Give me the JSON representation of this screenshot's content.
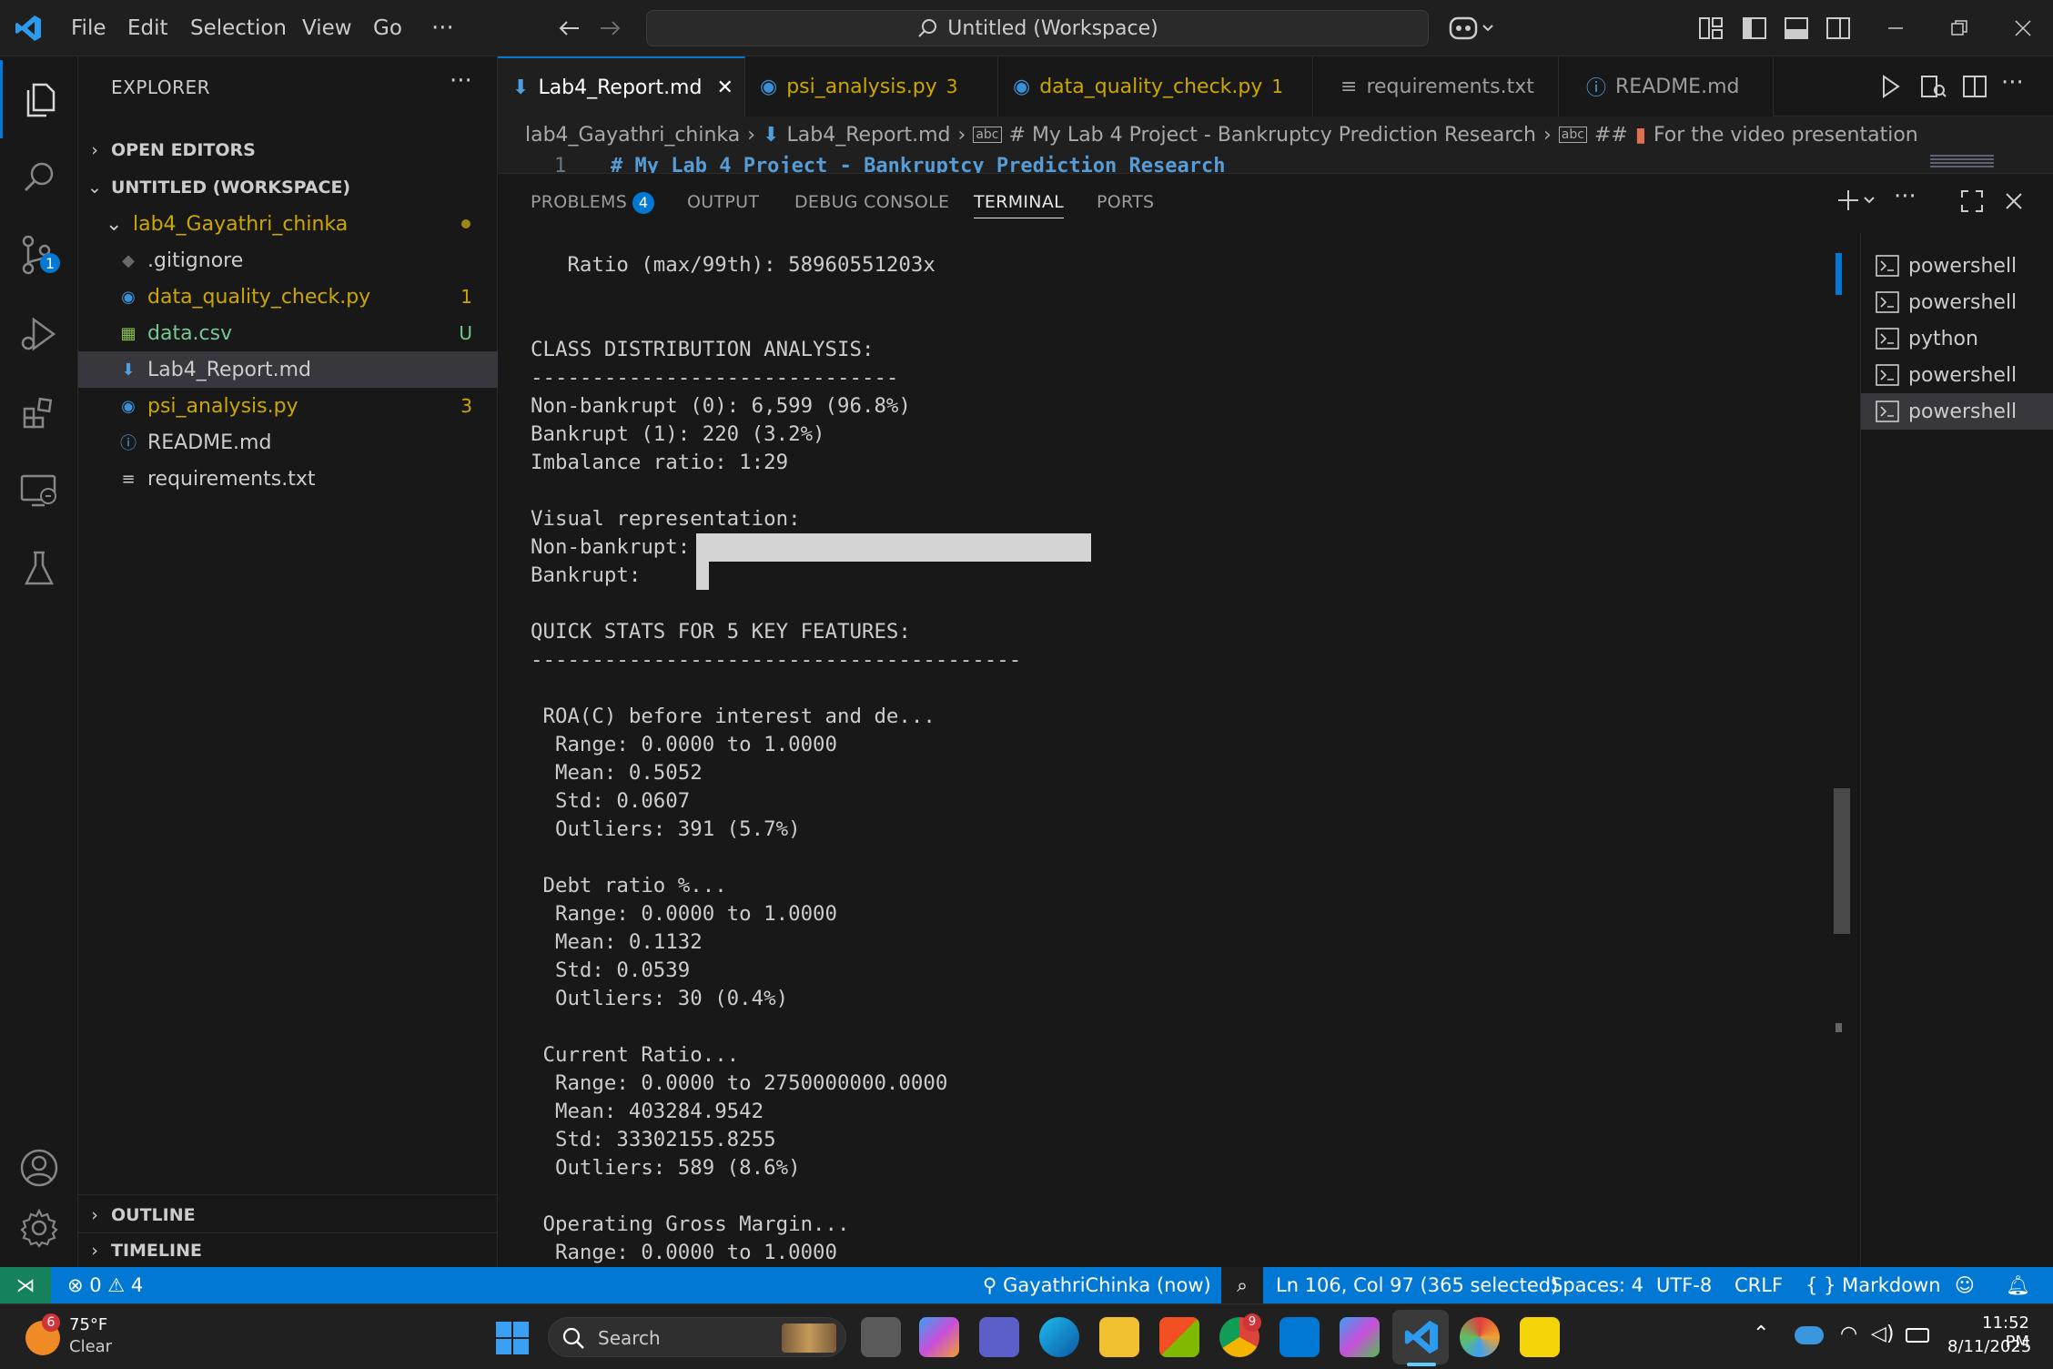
{
  "titlebar": {
    "menu": [
      "File",
      "Edit",
      "Selection",
      "View",
      "Go"
    ],
    "more": "···",
    "command_center": "Untitled (Workspace)"
  },
  "sidebar": {
    "title": "EXPLORER",
    "more": "···",
    "open_editors": "OPEN EDITORS",
    "workspace": "UNTITLED (WORKSPACE)",
    "folder": "lab4_Gayathri_chinka",
    "files": [
      {
        "name": ".gitignore",
        "badge": "",
        "color": "#cccccc",
        "icon": "gitignore-icon"
      },
      {
        "name": "data_quality_check.py",
        "badge": "1",
        "color": "#cca700",
        "icon": "python-icon"
      },
      {
        "name": "data.csv",
        "badge": "U",
        "color": "#73c991",
        "icon": "csv-icon"
      },
      {
        "name": "Lab4_Report.md",
        "badge": "",
        "color": "#cccccc",
        "icon": "markdown-icon"
      },
      {
        "name": "psi_analysis.py",
        "badge": "3",
        "color": "#cca700",
        "icon": "python-icon"
      },
      {
        "name": "README.md",
        "badge": "",
        "color": "#cccccc",
        "icon": "info-icon"
      },
      {
        "name": "requirements.txt",
        "badge": "",
        "color": "#cccccc",
        "icon": "text-file-icon"
      }
    ],
    "outline": "OUTLINE",
    "timeline": "TIMELINE"
  },
  "tabs": [
    {
      "label": "Lab4_Report.md",
      "num": "",
      "active": true
    },
    {
      "label": "psi_analysis.py",
      "num": "3",
      "active": false
    },
    {
      "label": "data_quality_check.py",
      "num": "1",
      "active": false
    },
    {
      "label": "requirements.txt",
      "num": "",
      "active": false
    },
    {
      "label": "README.md",
      "num": "",
      "active": false
    }
  ],
  "breadcrumb": {
    "folder": "lab4_Gayathri_chinka",
    "file": "Lab4_Report.md",
    "h1": "# My Lab 4 Project - Bankruptcy Prediction Research",
    "h2": "##",
    "h3": "For the video presentation"
  },
  "editor": {
    "line_no": "1",
    "line_text": "# My Lab 4 Project - Bankruptcy Prediction Research"
  },
  "panel": {
    "tabs": [
      "PROBLEMS",
      "OUTPUT",
      "DEBUG CONSOLE",
      "TERMINAL",
      "PORTS"
    ],
    "problems_count": "4",
    "active": "TERMINAL"
  },
  "terminal": {
    "lines": [
      "   Ratio (max/99th): 58960551203x",
      "",
      "",
      "CLASS DISTRIBUTION ANALYSIS:",
      "------------------------------",
      "Non-bankrupt (0): 6,599 (96.8%)",
      "Bankrupt (1): 220 (3.2%)",
      "Imbalance ratio: 1:29",
      "",
      "Visual representation:",
      "Non-bankrupt: ",
      "Bankrupt:     ",
      "",
      "QUICK STATS FOR 5 KEY FEATURES:",
      "----------------------------------------",
      "",
      " ROA(C) before interest and de...",
      "  Range: 0.0000 to 1.0000",
      "  Mean: 0.5052",
      "  Std: 0.0607",
      "  Outliers: 391 (5.7%)",
      "",
      " Debt ratio %...",
      "  Range: 0.0000 to 1.0000",
      "  Mean: 0.1132",
      "  Std: 0.0539",
      "  Outliers: 30 (0.4%)",
      "",
      " Current Ratio...",
      "  Range: 0.0000 to 2750000000.0000",
      "  Mean: 403284.9542",
      "  Std: 33302155.8255",
      "  Outliers: 589 (8.6%)",
      "",
      " Operating Gross Margin...",
      "  Range: 0.0000 to 1.0000"
    ],
    "bars": {
      "non_bankrupt_share": 0.968,
      "bankrupt_share": 0.032
    },
    "sessions": [
      "powershell",
      "powershell",
      "python",
      "powershell",
      "powershell"
    ]
  },
  "statusbar": {
    "errors": "0",
    "warnings": "4",
    "account": "GayathriChinka (now)",
    "position": "Ln 106, Col 97 (365 selected)",
    "spaces": "Spaces: 4",
    "encoding": "UTF-8",
    "eol": "CRLF",
    "language": "Markdown",
    "brand": "#0078d4"
  },
  "taskbar": {
    "weather_badge": "6",
    "temp": "75°F",
    "condition": "Clear",
    "search": "Search",
    "chrome_badge": "9",
    "time": "11:52 PM",
    "date": "8/11/2025"
  }
}
